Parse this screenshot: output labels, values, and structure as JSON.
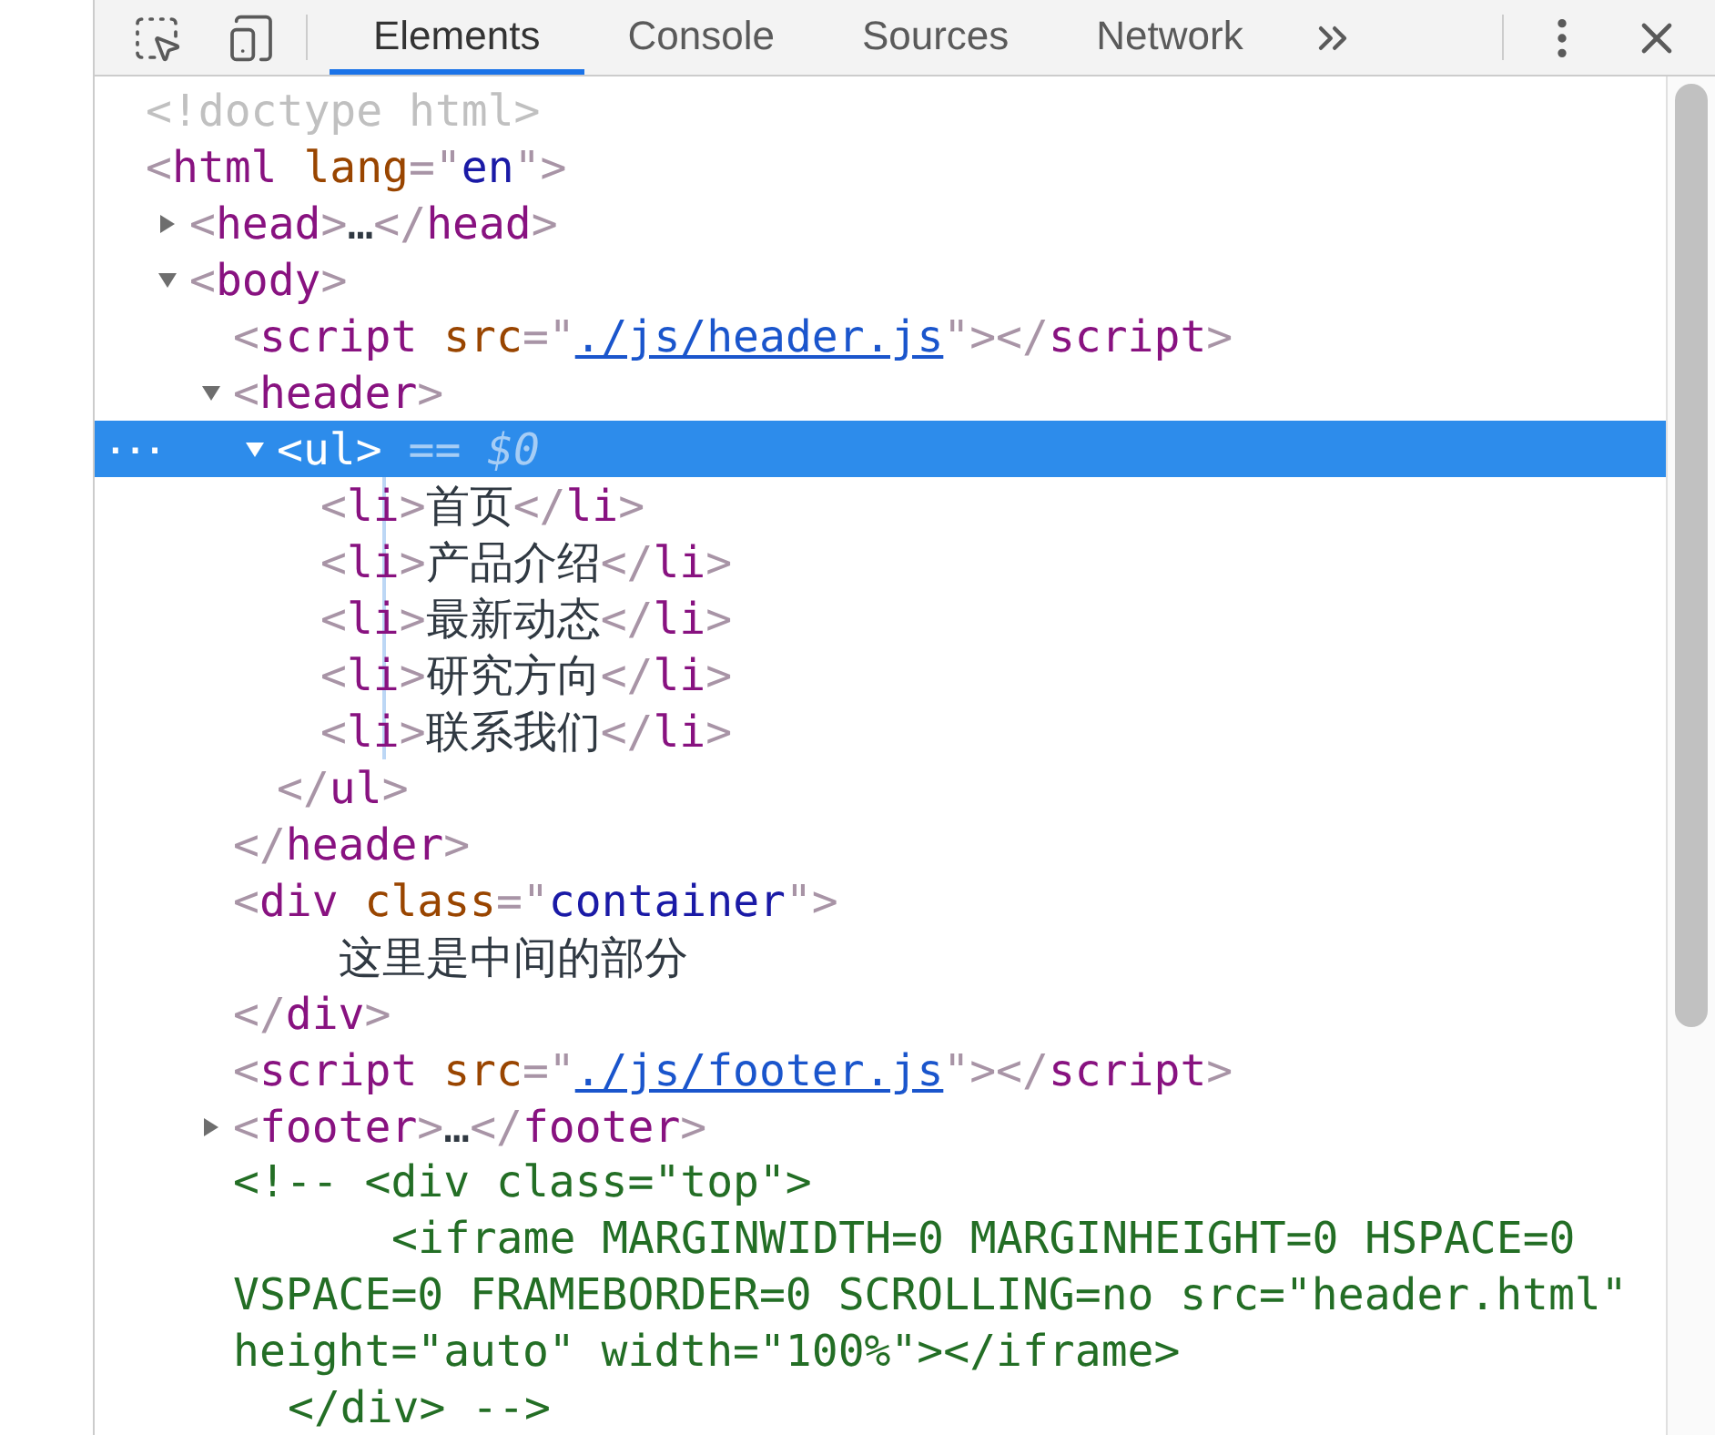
{
  "tabs": [
    {
      "label": "Elements",
      "selected": true
    },
    {
      "label": "Console",
      "selected": false
    },
    {
      "label": "Sources",
      "selected": false
    },
    {
      "label": "Network",
      "selected": false
    }
  ],
  "tree": [
    {
      "kind": "doctype",
      "text": "<!doctype html>"
    },
    {
      "kind": "element",
      "tokens": [
        {
          "kind": "p",
          "t": "<"
        },
        {
          "kind": "tag",
          "t": "html"
        },
        {
          "kind": "attr",
          "t": " lang"
        },
        {
          "kind": "p",
          "t": "=\""
        },
        {
          "kind": "val",
          "t": "en"
        },
        {
          "kind": "p",
          "t": "\">"
        }
      ],
      "children": [
        {
          "kind": "element",
          "expanded": false,
          "tokens": [
            {
              "kind": "p",
              "t": "<"
            },
            {
              "kind": "tag",
              "t": "head"
            },
            {
              "kind": "p",
              "t": ">"
            },
            {
              "kind": "dots",
              "t": "…"
            },
            {
              "kind": "p",
              "t": "</"
            },
            {
              "kind": "tag",
              "t": "head"
            },
            {
              "kind": "p",
              "t": ">"
            }
          ]
        },
        {
          "kind": "element",
          "expanded": true,
          "tokens": [
            {
              "kind": "p",
              "t": "<"
            },
            {
              "kind": "tag",
              "t": "body"
            },
            {
              "kind": "p",
              "t": ">"
            }
          ],
          "children": [
            {
              "kind": "element",
              "tokens": [
                {
                  "kind": "p",
                  "t": "<"
                },
                {
                  "kind": "tag",
                  "t": "script"
                },
                {
                  "kind": "attr",
                  "t": " src"
                },
                {
                  "kind": "p",
                  "t": "=\""
                },
                {
                  "kind": "link",
                  "t": "./js/header.js"
                },
                {
                  "kind": "p",
                  "t": "\"></"
                },
                {
                  "kind": "tag",
                  "t": "script"
                },
                {
                  "kind": "p",
                  "t": ">"
                }
              ]
            },
            {
              "kind": "element",
              "expanded": true,
              "tokens": [
                {
                  "kind": "p",
                  "t": "<"
                },
                {
                  "kind": "tag",
                  "t": "header"
                },
                {
                  "kind": "p",
                  "t": ">"
                }
              ],
              "children": [
                {
                  "kind": "element",
                  "expanded": true,
                  "selected": true,
                  "menu": "...",
                  "tokens": [
                    {
                      "kind": "p",
                      "t": "<"
                    },
                    {
                      "kind": "tag",
                      "t": "ul"
                    },
                    {
                      "kind": "p",
                      "t": ">"
                    },
                    {
                      "kind": "op",
                      "t": " == "
                    },
                    {
                      "kind": "ref",
                      "t": "$0"
                    }
                  ],
                  "children": [
                    {
                      "kind": "element",
                      "selected": false,
                      "tokens": [
                        {
                          "kind": "p",
                          "t": "<"
                        },
                        {
                          "kind": "tag",
                          "t": "li"
                        },
                        {
                          "kind": "p",
                          "t": ">"
                        },
                        {
                          "kind": "text",
                          "t": "首页"
                        },
                        {
                          "kind": "p",
                          "t": "</"
                        },
                        {
                          "kind": "tag",
                          "t": "li"
                        },
                        {
                          "kind": "p",
                          "t": ">"
                        }
                      ]
                    },
                    {
                      "kind": "element",
                      "selected": false,
                      "tokens": [
                        {
                          "kind": "p",
                          "t": "<"
                        },
                        {
                          "kind": "tag",
                          "t": "li"
                        },
                        {
                          "kind": "p",
                          "t": ">"
                        },
                        {
                          "kind": "text",
                          "t": "产品介绍"
                        },
                        {
                          "kind": "p",
                          "t": "</"
                        },
                        {
                          "kind": "tag",
                          "t": "li"
                        },
                        {
                          "kind": "p",
                          "t": ">"
                        }
                      ]
                    },
                    {
                      "kind": "element",
                      "selected": false,
                      "tokens": [
                        {
                          "kind": "p",
                          "t": "<"
                        },
                        {
                          "kind": "tag",
                          "t": "li"
                        },
                        {
                          "kind": "p",
                          "t": ">"
                        },
                        {
                          "kind": "text",
                          "t": "最新动态"
                        },
                        {
                          "kind": "p",
                          "t": "</"
                        },
                        {
                          "kind": "tag",
                          "t": "li"
                        },
                        {
                          "kind": "p",
                          "t": ">"
                        }
                      ]
                    },
                    {
                      "kind": "element",
                      "selected": false,
                      "tokens": [
                        {
                          "kind": "p",
                          "t": "<"
                        },
                        {
                          "kind": "tag",
                          "t": "li"
                        },
                        {
                          "kind": "p",
                          "t": ">"
                        },
                        {
                          "kind": "text",
                          "t": "研究方向"
                        },
                        {
                          "kind": "p",
                          "t": "</"
                        },
                        {
                          "kind": "tag",
                          "t": "li"
                        },
                        {
                          "kind": "p",
                          "t": ">"
                        }
                      ]
                    },
                    {
                      "kind": "element",
                      "selected": false,
                      "tokens": [
                        {
                          "kind": "p",
                          "t": "<"
                        },
                        {
                          "kind": "tag",
                          "t": "li"
                        },
                        {
                          "kind": "p",
                          "t": ">"
                        },
                        {
                          "kind": "text",
                          "t": "联系我们"
                        },
                        {
                          "kind": "p",
                          "t": "</"
                        },
                        {
                          "kind": "tag",
                          "t": "li"
                        },
                        {
                          "kind": "p",
                          "t": ">"
                        }
                      ]
                    }
                  ],
                  "close": [
                    {
                      "kind": "p",
                      "t": "</"
                    },
                    {
                      "kind": "tag",
                      "t": "ul"
                    },
                    {
                      "kind": "p",
                      "t": ">"
                    }
                  ]
                }
              ],
              "close": [
                {
                  "kind": "p",
                  "t": "</"
                },
                {
                  "kind": "tag",
                  "t": "header"
                },
                {
                  "kind": "p",
                  "t": ">"
                }
              ]
            },
            {
              "kind": "element",
              "tokens": [
                {
                  "kind": "p",
                  "t": "<"
                },
                {
                  "kind": "tag",
                  "t": "div"
                },
                {
                  "kind": "attr",
                  "t": " class"
                },
                {
                  "kind": "p",
                  "t": "=\""
                },
                {
                  "kind": "val",
                  "t": "container"
                },
                {
                  "kind": "p",
                  "t": "\">"
                }
              ],
              "children": [
                {
                  "kind": "text",
                  "text": "这里是中间的部分"
                }
              ],
              "close": [
                {
                  "kind": "p",
                  "t": "</"
                },
                {
                  "kind": "tag",
                  "t": "div"
                },
                {
                  "kind": "p",
                  "t": ">"
                }
              ]
            },
            {
              "kind": "element",
              "tokens": [
                {
                  "kind": "p",
                  "t": "<"
                },
                {
                  "kind": "tag",
                  "t": "script"
                },
                {
                  "kind": "attr",
                  "t": " src"
                },
                {
                  "kind": "p",
                  "t": "=\""
                },
                {
                  "kind": "link",
                  "t": "./js/footer.js"
                },
                {
                  "kind": "p",
                  "t": "\"></"
                },
                {
                  "kind": "tag",
                  "t": "script"
                },
                {
                  "kind": "p",
                  "t": ">"
                }
              ]
            },
            {
              "kind": "element",
              "expanded": false,
              "tokens": [
                {
                  "kind": "p",
                  "t": "<"
                },
                {
                  "kind": "tag",
                  "t": "footer"
                },
                {
                  "kind": "p",
                  "t": ">"
                },
                {
                  "kind": "dots",
                  "t": "…"
                },
                {
                  "kind": "p",
                  "t": "</"
                },
                {
                  "kind": "tag",
                  "t": "footer"
                },
                {
                  "kind": "p",
                  "t": ">"
                }
              ]
            },
            {
              "kind": "comment",
              "lines": [
                "<!-- <div class=\"top\">",
                "<iframe MARGINWIDTH=0 MARGINHEIGHT=0 HSPACE=0 VSPACE=0 FRAMEBORDER=0 SCROLLING=no src=\"header.html\" height=\"auto\" width=\"100%\"></iframe>",
                "</div> -->"
              ]
            }
          ]
        }
      ]
    }
  ]
}
